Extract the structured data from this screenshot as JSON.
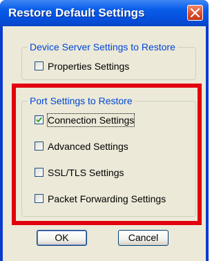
{
  "window": {
    "title": "Restore Default Settings",
    "close_icon": "close-icon"
  },
  "device_group": {
    "label": "Device Server Settings to Restore",
    "items": [
      {
        "label": "Properties Settings",
        "checked": false
      }
    ]
  },
  "port_group": {
    "label": "Port Settings to Restore",
    "items": [
      {
        "label": "Connection Settings",
        "checked": true
      },
      {
        "label": "Advanced Settings",
        "checked": false
      },
      {
        "label": "SSL/TLS Settings",
        "checked": false
      },
      {
        "label": "Packet Forwarding Settings",
        "checked": false
      }
    ]
  },
  "buttons": {
    "ok": "OK",
    "cancel": "Cancel"
  },
  "colors": {
    "title_bar": "#0a5ee8",
    "group_label": "#0046d5",
    "annotation_highlight": "#e3000f",
    "dialog_background": "#ece9d8"
  }
}
